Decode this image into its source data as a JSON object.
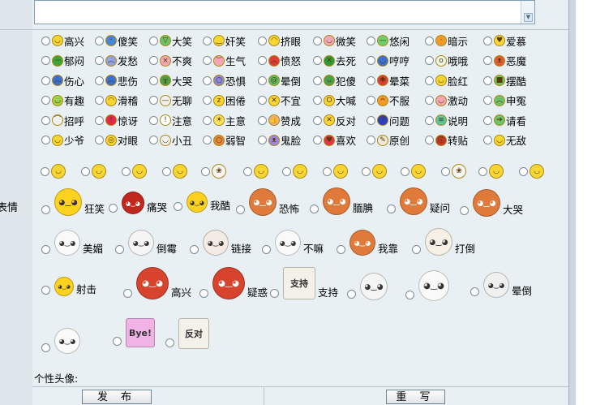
{
  "left": {
    "label": "表情"
  },
  "avatar": {
    "label": "个性头像:"
  },
  "buttons": {
    "publish": "发 布",
    "reset": "重 写"
  },
  "small_rows": [
    [
      {
        "label": "高兴",
        "icon": "smile-icon",
        "face": "◡"
      },
      {
        "label": "傻笑",
        "icon": "silly-icon",
        "face": "ᵕ"
      },
      {
        "label": "大笑",
        "icon": "laugh-icon",
        "face": "▽"
      },
      {
        "label": "奸笑",
        "icon": "smirk-icon",
        "face": "‿"
      },
      {
        "label": "挤眼",
        "icon": "wink-icon",
        "face": "◠"
      },
      {
        "label": "微笑",
        "icon": "slight-smile-icon",
        "face": "◡"
      },
      {
        "label": "悠闲",
        "icon": "relaxed-icon",
        "face": "—"
      },
      {
        "label": "暗示",
        "icon": "hint-icon",
        "face": "·"
      },
      {
        "label": "爱慕",
        "icon": "adore-icon",
        "face": "♥"
      }
    ],
    [
      {
        "label": "郁闷",
        "icon": "gloomy-icon",
        "face": "~"
      },
      {
        "label": "发愁",
        "icon": "worried-icon",
        "face": "︵"
      },
      {
        "label": "不爽",
        "icon": "upset-icon",
        "face": "×"
      },
      {
        "label": "生气",
        "icon": "angry-icon",
        "face": "︶"
      },
      {
        "label": "愤怒",
        "icon": "furious-icon",
        "face": "︿"
      },
      {
        "label": "去死",
        "icon": "die-icon",
        "face": "✕"
      },
      {
        "label": "哼哼",
        "icon": "humph-icon",
        "face": "◡"
      },
      {
        "label": "哦哦",
        "icon": "oh-icon",
        "face": "o"
      },
      {
        "label": "恶魔",
        "icon": "devil-icon",
        "face": "ᴥ"
      }
    ],
    [
      {
        "label": "伤心",
        "icon": "sad-icon",
        "face": "︵"
      },
      {
        "label": "悲伤",
        "icon": "grief-icon",
        "face": "︵"
      },
      {
        "label": "大哭",
        "icon": "cry-icon",
        "face": "╥"
      },
      {
        "label": "恐惧",
        "icon": "fear-icon",
        "face": "○"
      },
      {
        "label": "晕倒",
        "icon": "faint-icon",
        "face": "@"
      },
      {
        "label": "犯傻",
        "icon": "dumb-icon",
        "face": "ᴗ"
      },
      {
        "label": "晕菜",
        "icon": "dizzy-icon",
        "face": "✱"
      },
      {
        "label": "脸红",
        "icon": "blush-icon",
        "face": "◡"
      },
      {
        "label": "摆酷",
        "icon": "cool-icon",
        "face": "■"
      }
    ],
    [
      {
        "label": "有趣",
        "icon": "funny-icon",
        "face": "◡"
      },
      {
        "label": "滑稽",
        "icon": "comic-icon",
        "face": "◠"
      },
      {
        "label": "无聊",
        "icon": "bored-icon",
        "face": "—"
      },
      {
        "label": "困倦",
        "icon": "sleepy-icon",
        "face": "z"
      },
      {
        "label": "不宜",
        "icon": "forbidden-icon",
        "face": "✕"
      },
      {
        "label": "大喊",
        "icon": "shout-icon",
        "face": "O"
      },
      {
        "label": "不服",
        "icon": "defiant-icon",
        "face": "ᴖ"
      },
      {
        "label": "激动",
        "icon": "excited-icon",
        "face": "◡"
      },
      {
        "label": "申冤",
        "icon": "complain-icon",
        "face": "︿"
      }
    ],
    [
      {
        "label": "招呼",
        "icon": "greet-icon",
        "face": "⌒"
      },
      {
        "label": "惊讶",
        "icon": "surprise-icon",
        "face": "!"
      },
      {
        "label": "注意",
        "icon": "warning-icon",
        "face": "!"
      },
      {
        "label": "主意",
        "icon": "idea-icon",
        "face": "☀"
      },
      {
        "label": "赞成",
        "icon": "thumbs-up-icon",
        "face": "👍"
      },
      {
        "label": "反对",
        "icon": "oppose-icon",
        "face": "✕"
      },
      {
        "label": "问题",
        "icon": "question-icon",
        "face": "?"
      },
      {
        "label": "说明",
        "icon": "info-icon",
        "face": "≡"
      },
      {
        "label": "请看",
        "icon": "arrow-icon",
        "face": "➔"
      }
    ],
    [
      {
        "label": "少爷",
        "icon": "master-icon",
        "face": "◡"
      },
      {
        "label": "对眼",
        "icon": "cross-eyed-icon",
        "face": "◎"
      },
      {
        "label": "小丑",
        "icon": "clown-icon",
        "face": "◡"
      },
      {
        "label": "弱智",
        "icon": "silly-face-icon",
        "face": "○"
      },
      {
        "label": "鬼脸",
        "icon": "grimace-icon",
        "face": "ᴥ"
      },
      {
        "label": "喜欢",
        "icon": "heart-icon",
        "face": "♥"
      },
      {
        "label": "原创",
        "icon": "original-icon",
        "face": "✎"
      },
      {
        "label": "转贴",
        "icon": "repost-icon",
        "face": "⎘"
      },
      {
        "label": "无敌",
        "icon": "invincible-icon",
        "face": "◡"
      }
    ]
  ],
  "emoji_row": [
    "emoji-1-icon",
    "emoji-2-icon",
    "emoji-3-icon",
    "emoji-4-icon",
    "rose-icon",
    "emoji-6-icon",
    "emoji-7-icon",
    "emoji-8-icon",
    "emoji-9-icon",
    "emoji-10-icon",
    "rose-2-icon",
    "emoji-12-icon",
    "emoji-13-icon"
  ],
  "big_rows": [
    [
      {
        "label": "狂笑",
        "icon": "laugh-hard-icon"
      },
      {
        "label": "痛哭",
        "icon": "wail-icon"
      },
      {
        "label": "我酷",
        "icon": "im-cool-icon"
      },
      {
        "label": "恐怖",
        "icon": "scary-icon"
      },
      {
        "label": "腼腆",
        "icon": "shy-icon"
      },
      {
        "label": "疑问",
        "icon": "doubt-icon"
      },
      {
        "label": "大哭",
        "icon": "big-cry-icon"
      }
    ],
    [
      {
        "label": "美媚",
        "icon": "beauty-icon"
      },
      {
        "label": "倒霉",
        "icon": "unlucky-icon"
      },
      {
        "label": "链接",
        "icon": "link-icon"
      },
      {
        "label": "不嘛",
        "icon": "no-way-icon"
      },
      {
        "label": "我靠",
        "icon": "damn-icon"
      },
      {
        "label": "打倒",
        "icon": "knock-down-icon"
      }
    ],
    [
      {
        "label": "射击",
        "icon": "shoot-icon"
      },
      {
        "label": "高兴",
        "icon": "happy-boy-icon"
      },
      {
        "label": "疑惑",
        "icon": "puzzled-boy-icon"
      },
      {
        "label": "支持",
        "icon": "support-sign-icon",
        "sign": "支持"
      },
      {
        "label": "",
        "icon": "ghost-icon"
      },
      {
        "label": "",
        "icon": "star-blob-icon"
      },
      {
        "label": "晕倒",
        "icon": "faint-eyes-icon"
      }
    ],
    [
      {
        "label": "",
        "icon": "bunny-icon"
      },
      {
        "label": "",
        "icon": "bye-blob-icon",
        "sign": "Bye!"
      },
      {
        "label": "",
        "icon": "oppose-sign-icon",
        "sign": "反对"
      }
    ]
  ]
}
